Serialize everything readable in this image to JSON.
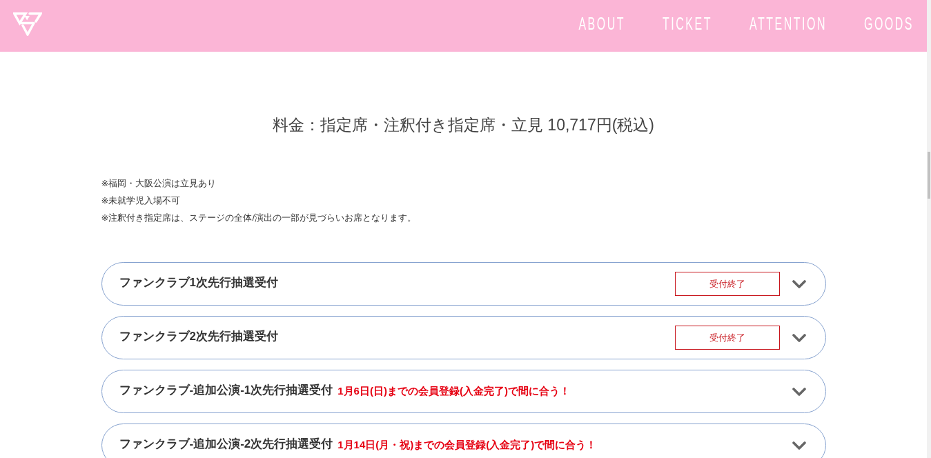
{
  "header": {
    "nav": [
      {
        "label": "ABOUT"
      },
      {
        "label": "TICKET"
      },
      {
        "label": "ATTENTION"
      },
      {
        "label": "GOODS"
      }
    ]
  },
  "section": {
    "price": "料金：指定席・注釈付き指定席・立見 10,717円(税込)",
    "notes": [
      "※福岡・大阪公演は立見あり",
      "※未就学児入場不可",
      "※注釈付き指定席は、ステージの全体/演出の一部が見づらいお席となります。"
    ],
    "accordion": [
      {
        "kind": "badge",
        "title": "ファンクラブ1次先行抽選受付",
        "badge": "受付終了",
        "expanded": false
      },
      {
        "kind": "badge",
        "title": "ファンクラブ2次先行抽選受付",
        "badge": "受付終了",
        "expanded": false
      },
      {
        "kind": "note",
        "title": "ファンクラブ-追加公演-1次先行抽選受付",
        "note": "1月6日(日)までの会員登録(入金完了)で間に合う！",
        "expanded": false
      },
      {
        "kind": "note",
        "title": "ファンクラブ-追加公演-2次先行抽選受付",
        "note": "1月14日(月・祝)までの会員登録(入金完了)で間に合う！",
        "expanded": false
      }
    ]
  }
}
